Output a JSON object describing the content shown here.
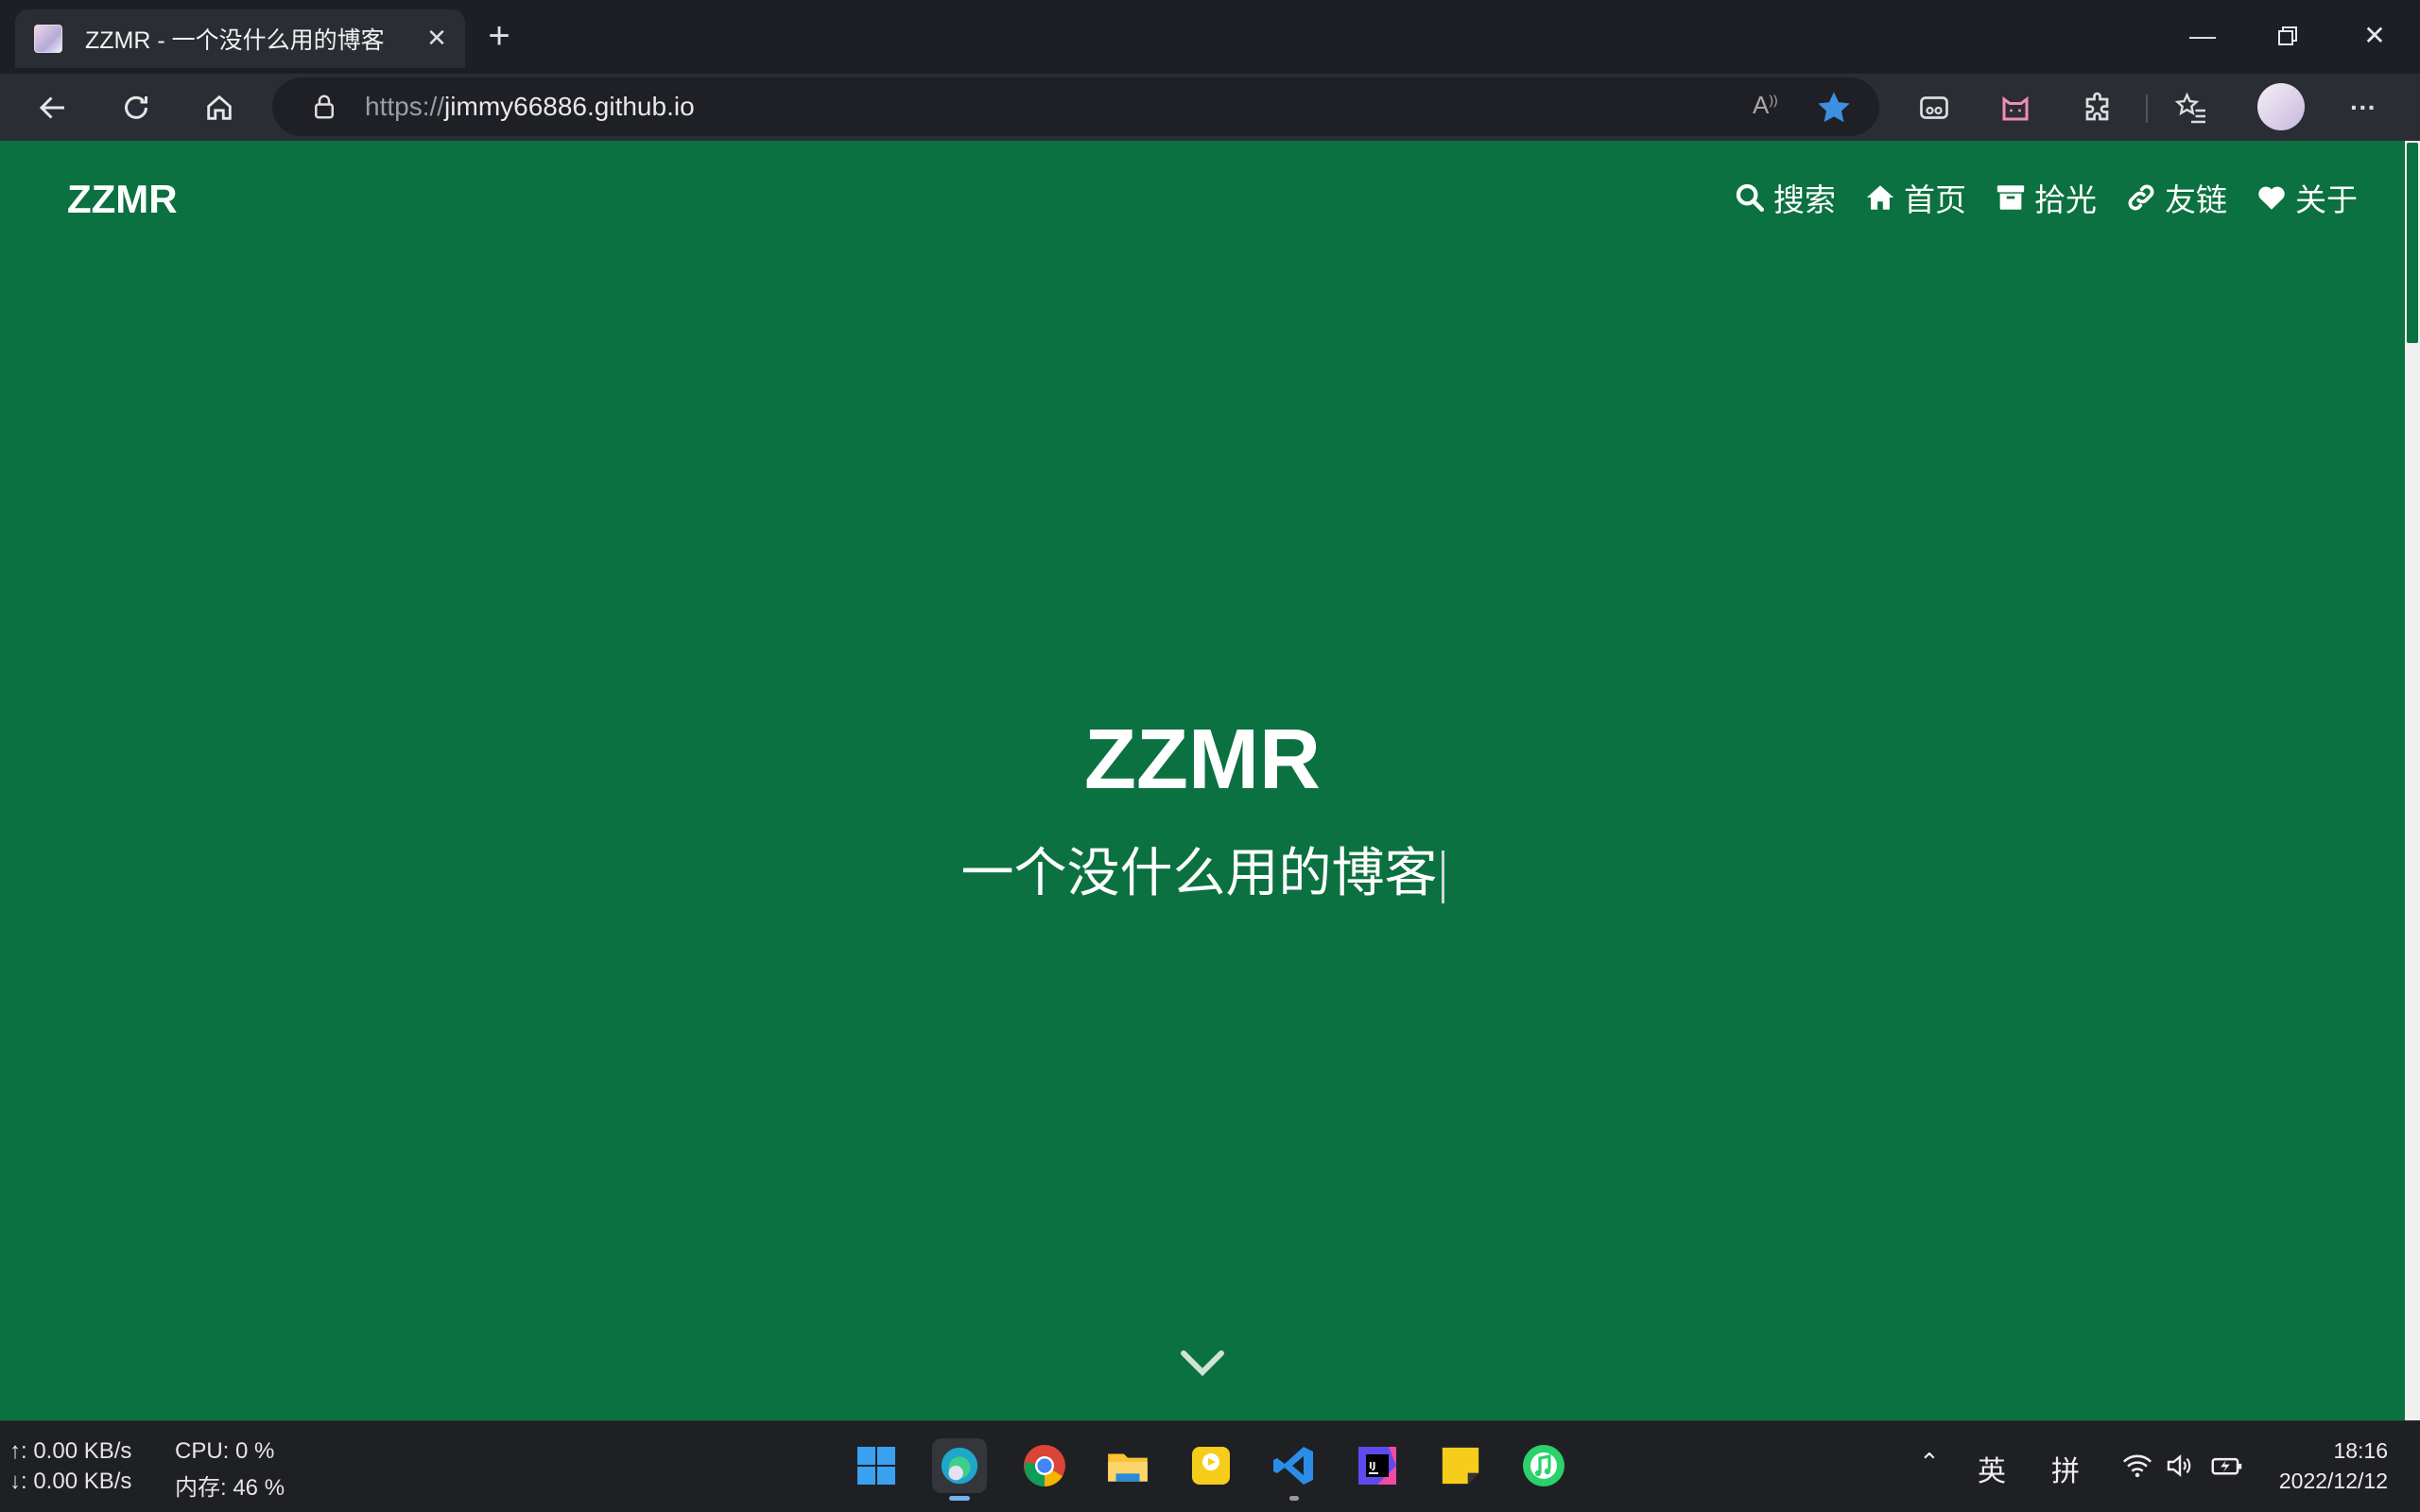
{
  "browser": {
    "tab_title": "ZZMR - 一个没什么用的博客",
    "url_protocol": "https://",
    "url_host": "jimmy66886.github.io"
  },
  "site": {
    "brand": "ZZMR",
    "nav": [
      {
        "label": "搜索",
        "icon": "search-icon"
      },
      {
        "label": "首页",
        "icon": "home-icon"
      },
      {
        "label": "拾光",
        "icon": "archive-icon"
      },
      {
        "label": "友链",
        "icon": "link-icon"
      },
      {
        "label": "关于",
        "icon": "heart-icon"
      }
    ],
    "hero_title": "ZZMR",
    "hero_subtitle": "一个没什么用的博客",
    "theme_color": "#0b7140"
  },
  "taskbar": {
    "upload": "↑: 0.00 KB/s",
    "download": "↓: 0.00 KB/s",
    "cpu": "CPU: 0 %",
    "memory": "内存: 46 %",
    "ime_lang": "英",
    "ime_mode": "拼",
    "time": "18:16",
    "date": "2022/12/12"
  }
}
